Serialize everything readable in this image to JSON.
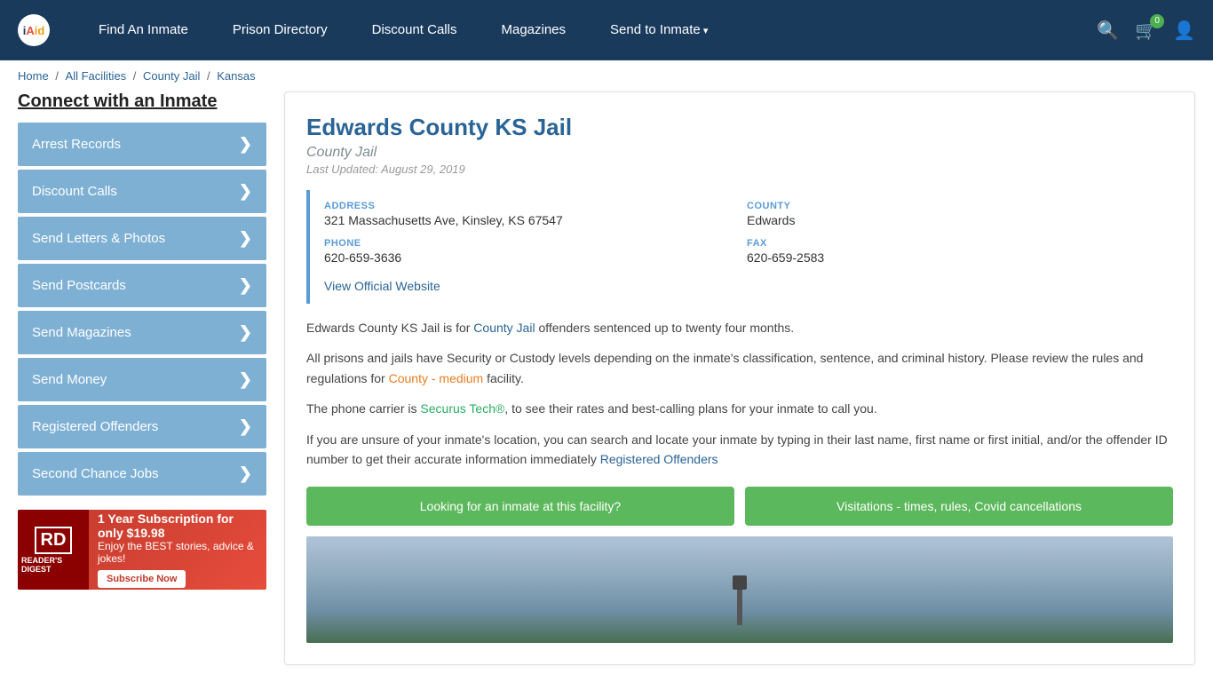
{
  "header": {
    "logo_text": "inmateAid",
    "nav": [
      {
        "label": "Find An Inmate",
        "has_arrow": false
      },
      {
        "label": "Prison Directory",
        "has_arrow": false
      },
      {
        "label": "Discount Calls",
        "has_arrow": false
      },
      {
        "label": "Magazines",
        "has_arrow": false
      },
      {
        "label": "Send to Inmate",
        "has_arrow": true
      }
    ],
    "cart_count": "0"
  },
  "breadcrumb": {
    "items": [
      "Home",
      "All Facilities",
      "County Jail",
      "Kansas"
    ]
  },
  "sidebar": {
    "title": "Connect with an Inmate",
    "menu_items": [
      "Arrest Records",
      "Discount Calls",
      "Send Letters & Photos",
      "Send Postcards",
      "Send Magazines",
      "Send Money",
      "Registered Offenders",
      "Second Chance Jobs"
    ],
    "ad": {
      "logo": "Rd",
      "brand": "READER'S DIGEST",
      "offer": "1 Year Subscription for only $19.98",
      "tagline": "Enjoy the BEST stories, advice & jokes!",
      "button_label": "Subscribe Now"
    }
  },
  "facility": {
    "name": "Edwards County KS Jail",
    "type": "County Jail",
    "last_updated": "Last Updated: August 29, 2019",
    "address_label": "ADDRESS",
    "address_value": "321 Massachusetts Ave, Kinsley, KS 67547",
    "county_label": "COUNTY",
    "county_value": "Edwards",
    "phone_label": "PHONE",
    "phone_value": "620-659-3636",
    "fax_label": "FAX",
    "fax_value": "620-659-2583",
    "website_label": "View Official Website",
    "description_1": "Edwards County KS Jail is for County Jail offenders sentenced up to twenty four months.",
    "description_2": "All prisons and jails have Security or Custody levels depending on the inmate's classification, sentence, and criminal history. Please review the rules and regulations for County - medium facility.",
    "description_3": "The phone carrier is Securus Tech®, to see their rates and best-calling plans for your inmate to call you.",
    "description_4": "If you are unsure of your inmate's location, you can search and locate your inmate by typing in their last name, first name or first initial, and/or the offender ID number to get their accurate information immediately Registered Offenders",
    "btn_inmate": "Looking for an inmate at this facility?",
    "btn_visitations": "Visitations - times, rules, Covid cancellations"
  }
}
